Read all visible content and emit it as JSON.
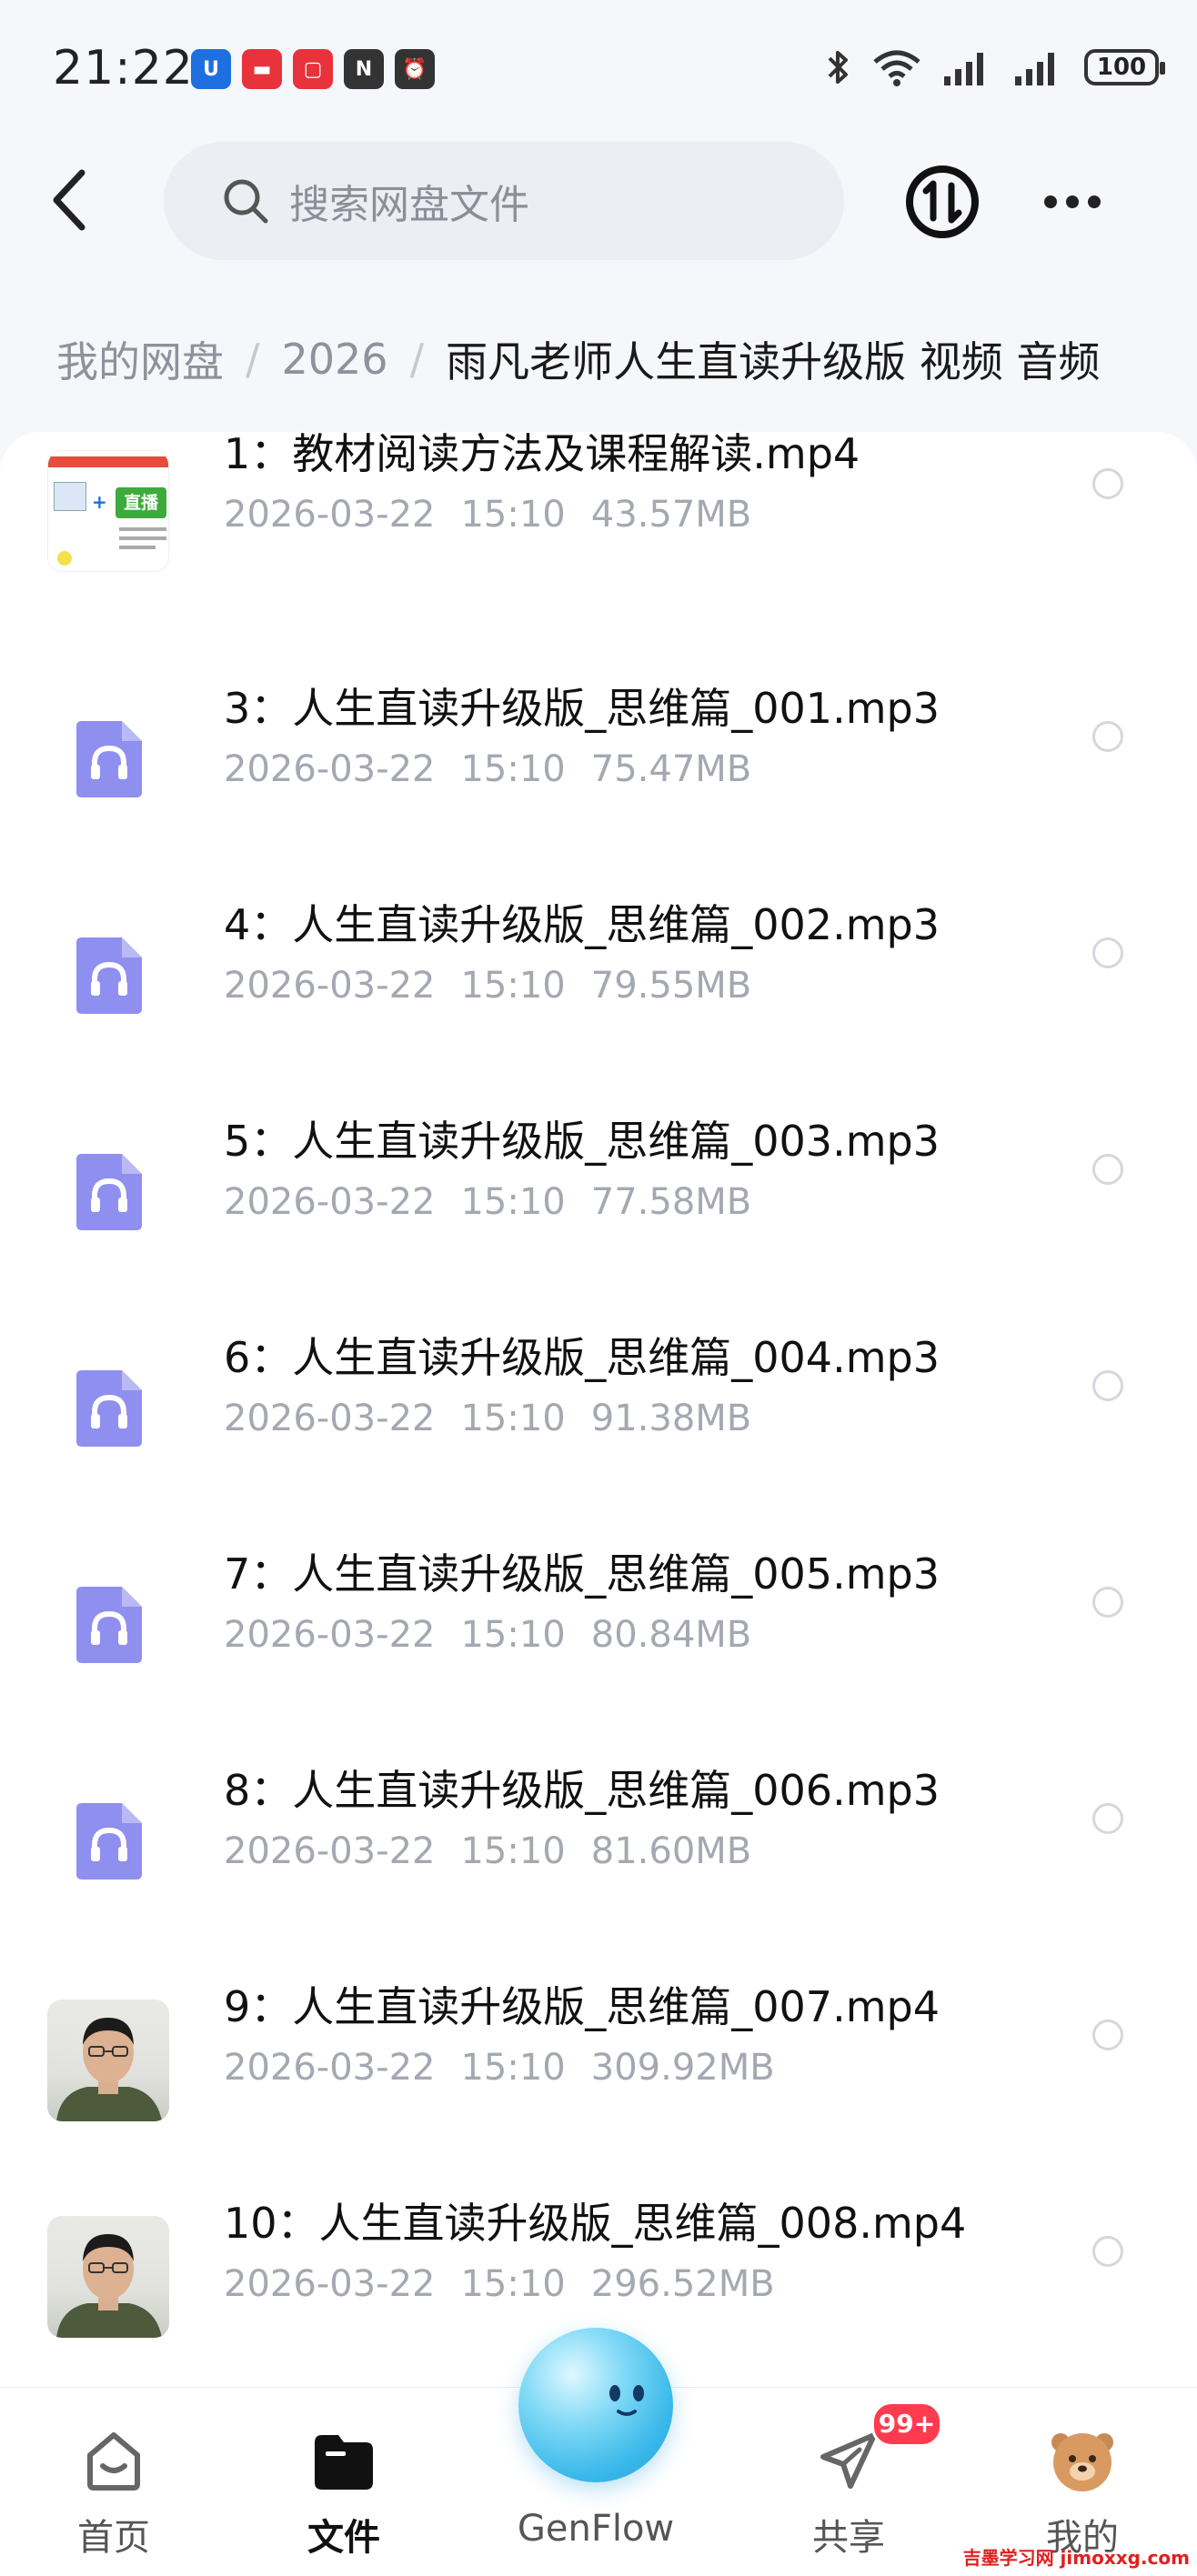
{
  "status_bar": {
    "time": "21:22",
    "battery": "100",
    "app_icons": [
      {
        "name": "app-icon-1",
        "color": "#1e6fe0",
        "glyph": "U"
      },
      {
        "name": "huawei-icon",
        "color": "#e8323c",
        "glyph": "▬"
      },
      {
        "name": "app-icon-3",
        "color": "#e8323c",
        "glyph": "▢"
      },
      {
        "name": "nfc-icon",
        "color": "#333333",
        "glyph": "N"
      },
      {
        "name": "alarm-icon",
        "color": "#333333",
        "glyph": "⏰"
      }
    ]
  },
  "header": {
    "search_placeholder": "搜索网盘文件"
  },
  "breadcrumb": {
    "root": "我的网盘",
    "year": "2026",
    "current": "雨凡老师人生直读升级版 视频 音频"
  },
  "files": [
    {
      "name": "1：教材阅读方法及课程解读.mp4",
      "date": "2026-03-22",
      "time": "15:10",
      "size": "43.57MB",
      "kind": "video-slide",
      "thumb_text": "直播"
    },
    {
      "name": "3：人生直读升级版_思维篇_001.mp3",
      "date": "2026-03-22",
      "time": "15:10",
      "size": "75.47MB",
      "kind": "audio"
    },
    {
      "name": "4：人生直读升级版_思维篇_002.mp3",
      "date": "2026-03-22",
      "time": "15:10",
      "size": "79.55MB",
      "kind": "audio"
    },
    {
      "name": "5：人生直读升级版_思维篇_003.mp3",
      "date": "2026-03-22",
      "time": "15:10",
      "size": "77.58MB",
      "kind": "audio"
    },
    {
      "name": "6：人生直读升级版_思维篇_004.mp3",
      "date": "2026-03-22",
      "time": "15:10",
      "size": "91.38MB",
      "kind": "audio"
    },
    {
      "name": "7：人生直读升级版_思维篇_005.mp3",
      "date": "2026-03-22",
      "time": "15:10",
      "size": "80.84MB",
      "kind": "audio"
    },
    {
      "name": "8：人生直读升级版_思维篇_006.mp3",
      "date": "2026-03-22",
      "time": "15:10",
      "size": "81.60MB",
      "kind": "audio"
    },
    {
      "name": "9：人生直读升级版_思维篇_007.mp4",
      "date": "2026-03-22",
      "time": "15:10",
      "size": "309.92MB",
      "kind": "video-person"
    },
    {
      "name": "10：人生直读升级版_思维篇_008.mp4",
      "date": "2026-03-22",
      "time": "15:10",
      "size": "296.52MB",
      "kind": "video-person"
    }
  ],
  "nav": {
    "home": "首页",
    "files": "文件",
    "genflow": "GenFlow",
    "share": "共享",
    "share_badge": "99+",
    "mine": "我的"
  },
  "watermark": "吉墨学习网 jimoxxg.com",
  "colors": {
    "accent_audio": "#8f8ff0",
    "badge": "#ff3b4f",
    "genflow": "#39b8ea"
  }
}
